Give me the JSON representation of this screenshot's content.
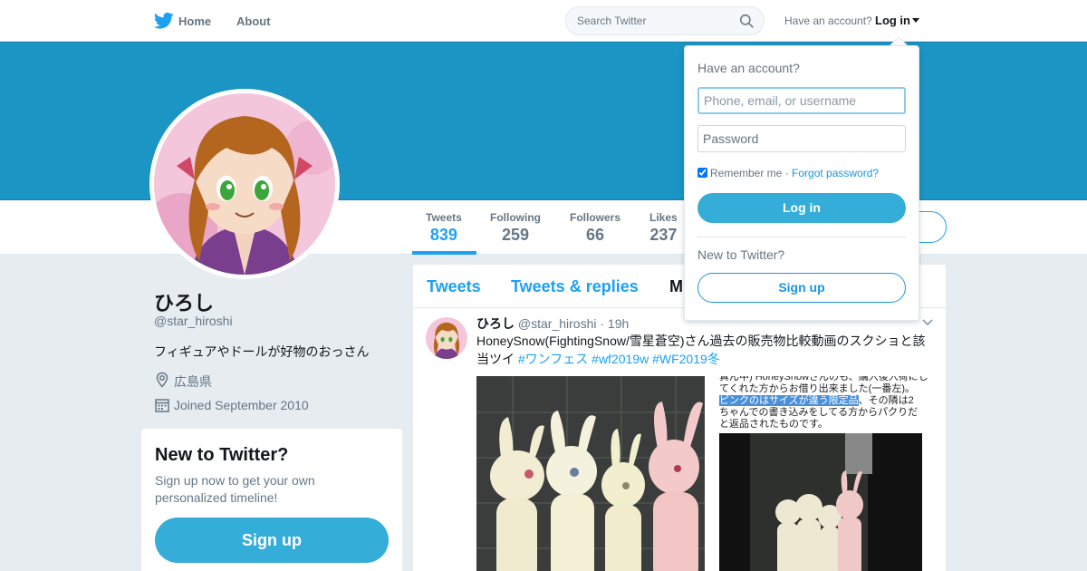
{
  "nav": {
    "home_label": "Home",
    "about_label": "About",
    "search_placeholder": "Search Twitter",
    "have_account": "Have an account?",
    "login_label": "Log in"
  },
  "stats": [
    {
      "label": "Tweets",
      "value": "839",
      "active": true
    },
    {
      "label": "Following",
      "value": "259",
      "active": false
    },
    {
      "label": "Followers",
      "value": "66",
      "active": false
    },
    {
      "label": "Likes",
      "value": "237",
      "active": false
    }
  ],
  "profile": {
    "name": "ひろし",
    "handle": "@star_hiroshi",
    "bio": "フィギュアやドールが好物のおっさん",
    "location": "広島県",
    "joined": "Joined September 2010"
  },
  "signup_card": {
    "title": "New to Twitter?",
    "text": "Sign up now to get your own personalized timeline!",
    "button": "Sign up"
  },
  "timeline": {
    "tabs": [
      "Tweets",
      "Tweets & replies",
      "M"
    ],
    "tweet": {
      "name": "ひろし",
      "handle": "@star_hiroshi",
      "time": "· 19h",
      "text": "HoneySnow(FightingSnow/雪星蒼空)さん過去の販売物比較動画のスクショと該当ツイ ",
      "hashtags": [
        "#ワンフェス",
        "#wf2019w",
        "#WF2019冬"
      ],
      "image_text_1": "真ん中) HoneySnowさんのも、購入後入荷にし",
      "image_text_2": "てくれた方からお借り出来ました(一番左)。",
      "image_text_hl": "ピンクのはサイズが違う限定品",
      "image_text_3": "、その隣は2",
      "image_text_4": "ちゃんでの書き込みをしてる方からパクりだ",
      "image_text_5": "と返品されたものです。"
    }
  },
  "login_dropdown": {
    "title": "Have an account?",
    "username_placeholder": "Phone, email, or username",
    "password_placeholder": "Password",
    "remember": "Remember me",
    "separator": " · ",
    "forgot": "Forgot password?",
    "login_button": "Log in",
    "new_to_twitter": "New to Twitter?",
    "signup_button": "Sign up"
  },
  "colors": {
    "accent": "#1da1f2",
    "banner": "#1b95c4",
    "button": "#35add9"
  }
}
